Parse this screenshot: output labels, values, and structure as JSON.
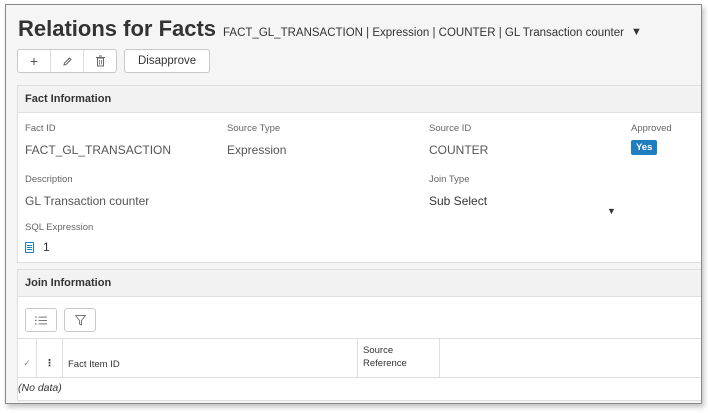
{
  "page": {
    "title": "Relations for Facts",
    "subtitle": "FACT_GL_TRANSACTION | Expression | COUNTER | GL Transaction counter"
  },
  "toolbar": {
    "add_icon": "+",
    "edit_icon": "✎",
    "delete_icon": "🗑",
    "disapprove_label": "Disapprove"
  },
  "fact_info": {
    "title": "Fact Information",
    "fact_id": {
      "label": "Fact ID",
      "value": "FACT_GL_TRANSACTION"
    },
    "source_type": {
      "label": "Source Type",
      "value": "Expression"
    },
    "source_id": {
      "label": "Source ID",
      "value": "COUNTER"
    },
    "approved": {
      "label": "Approved",
      "value": "Yes"
    },
    "description": {
      "label": "Description",
      "value": "GL Transaction counter"
    },
    "join_type": {
      "label": "Join Type",
      "value": "Sub Select"
    },
    "sql_expression": {
      "label": "SQL Expression",
      "value": "1"
    }
  },
  "join_info": {
    "title": "Join Information",
    "columns": {
      "fact_item_id": "Fact Item ID",
      "source_reference_1": "Source",
      "source_reference_2": "Reference"
    },
    "empty_text": "(No data)"
  },
  "colors": {
    "accent": "#1f7ec0",
    "background": "#f5f5f5"
  },
  "icons": [
    "add-icon",
    "edit-icon",
    "delete-icon",
    "chevron-down-icon",
    "document-icon",
    "list-icon",
    "filter-icon",
    "checkmark-icon",
    "more-vertical-icon"
  ]
}
